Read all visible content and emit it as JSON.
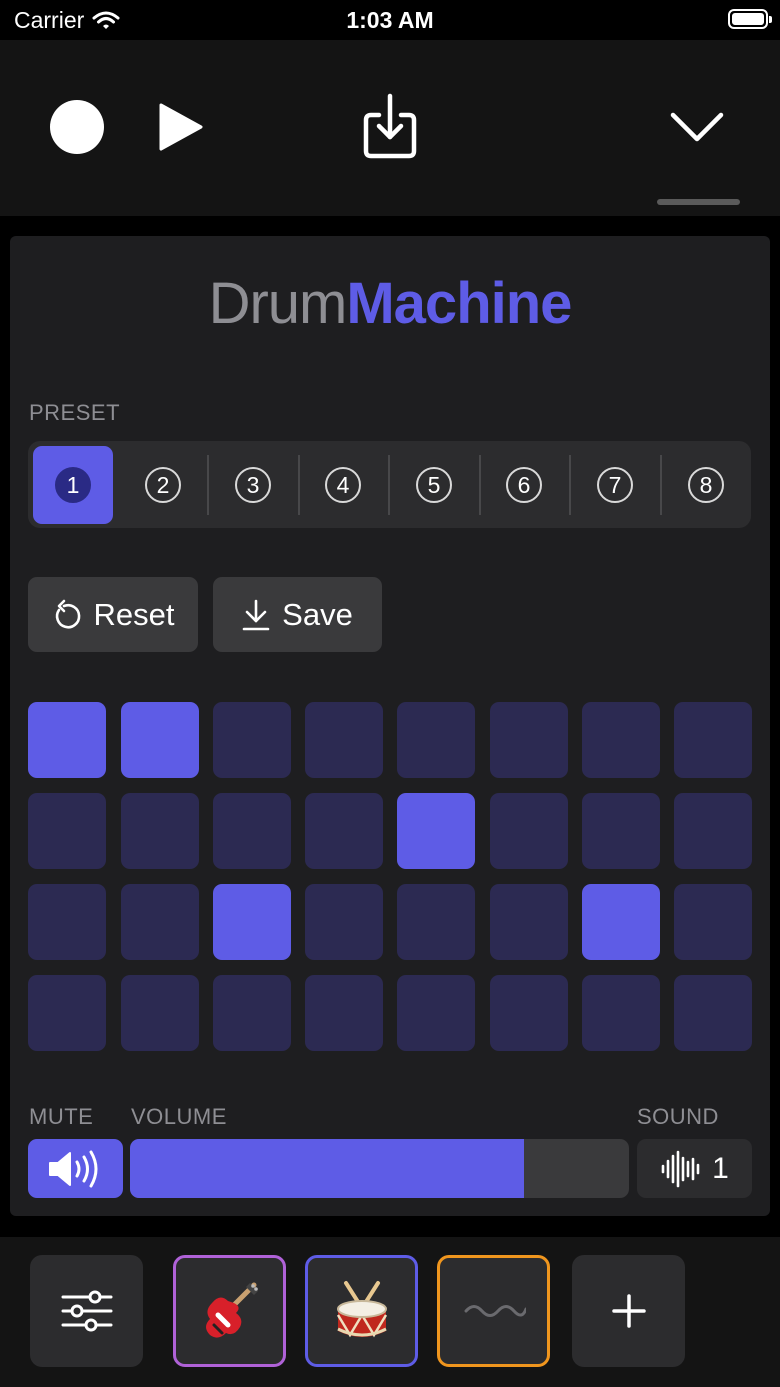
{
  "status_bar": {
    "carrier": "Carrier",
    "time": "1:03 AM"
  },
  "toolbar": {
    "record_icon": "record-icon",
    "play_icon": "play-icon",
    "export_icon": "export-icon",
    "collapse_icon": "chevron-down-icon"
  },
  "title": {
    "part1": "Drum",
    "part2": "Machine",
    "accent_color": "#5e5ce6"
  },
  "preset": {
    "label": "PRESET",
    "items": [
      "1",
      "2",
      "3",
      "4",
      "5",
      "6",
      "7",
      "8"
    ],
    "selected": "1"
  },
  "actions": {
    "reset_label": "Reset",
    "save_label": "Save"
  },
  "pads": {
    "rows": [
      [
        true,
        true,
        false,
        false,
        false,
        false,
        false,
        false
      ],
      [
        false,
        false,
        false,
        false,
        true,
        false,
        false,
        false
      ],
      [
        false,
        false,
        true,
        false,
        false,
        false,
        true,
        false
      ],
      [
        false,
        false,
        false,
        false,
        false,
        false,
        false,
        false
      ]
    ],
    "on_color": "#5e5ce6",
    "off_color": "#2c2a52"
  },
  "controls": {
    "mute_label": "MUTE",
    "volume_label": "VOLUME",
    "sound_label": "SOUND",
    "volume_level": 0.79,
    "sound_value": "1"
  },
  "instruments": [
    {
      "name": "settings",
      "icon": "sliders-icon"
    },
    {
      "name": "guitar",
      "icon": "guitar-icon",
      "border": "#b062d8"
    },
    {
      "name": "drum",
      "icon": "drum-icon",
      "border": "#5e5ce6"
    },
    {
      "name": "synth",
      "icon": "wave-icon",
      "border": "#f0961e"
    },
    {
      "name": "add",
      "icon": "plus-icon"
    }
  ]
}
